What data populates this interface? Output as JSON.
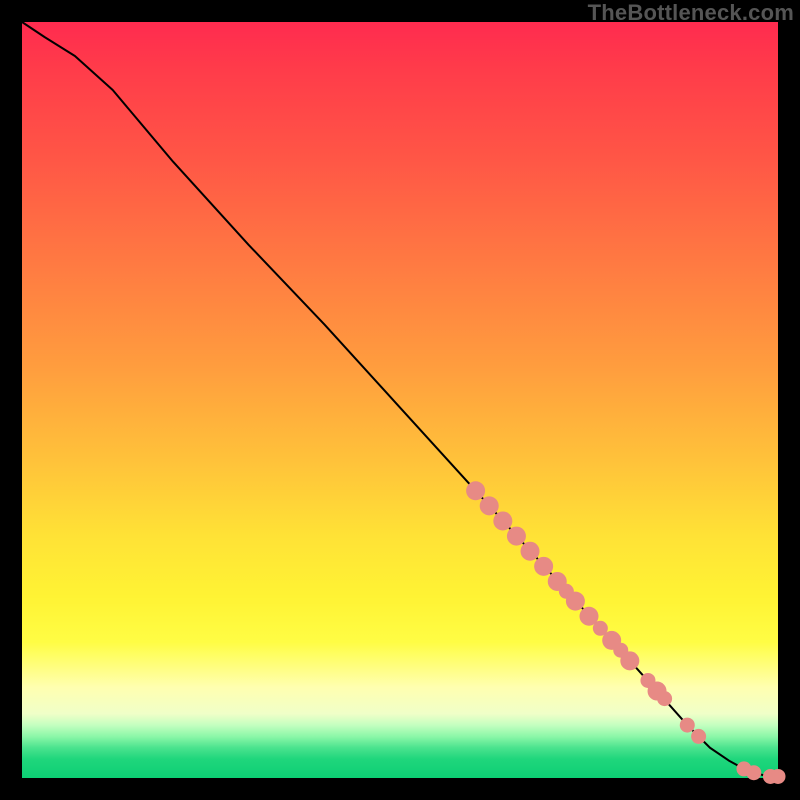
{
  "watermark": "TheBottleneck.com",
  "chart_data": {
    "type": "line",
    "title": "",
    "xlabel": "",
    "ylabel": "",
    "xlim": [
      0,
      100
    ],
    "ylim": [
      0,
      100
    ],
    "grid": false,
    "series": [
      {
        "name": "curve",
        "type": "line",
        "color": "#000000",
        "x": [
          0,
          3,
          7,
          12,
          20,
          30,
          40,
          50,
          60,
          70,
          78,
          84,
          88,
          91,
          93.5,
          95.5,
          97.5,
          99,
          100
        ],
        "y": [
          100,
          98,
          95.5,
          91,
          81.5,
          70.5,
          60,
          49,
          38,
          27,
          18.2,
          11.5,
          7,
          4,
          2.3,
          1.2,
          0.5,
          0.2,
          0.2
        ]
      },
      {
        "name": "markers",
        "type": "scatter",
        "color": "#e78a85",
        "radius_large": 9.5,
        "radius_small": 7.5,
        "points": [
          {
            "x": 60.0,
            "y": 38.0,
            "r": "large"
          },
          {
            "x": 61.8,
            "y": 36.0,
            "r": "large"
          },
          {
            "x": 63.6,
            "y": 34.0,
            "r": "large"
          },
          {
            "x": 65.4,
            "y": 32.0,
            "r": "large"
          },
          {
            "x": 67.2,
            "y": 30.0,
            "r": "large"
          },
          {
            "x": 69.0,
            "y": 28.0,
            "r": "large"
          },
          {
            "x": 70.8,
            "y": 26.0,
            "r": "large"
          },
          {
            "x": 72.0,
            "y": 24.7,
            "r": "small"
          },
          {
            "x": 73.2,
            "y": 23.4,
            "r": "large"
          },
          {
            "x": 75.0,
            "y": 21.4,
            "r": "large"
          },
          {
            "x": 76.5,
            "y": 19.8,
            "r": "small"
          },
          {
            "x": 78.0,
            "y": 18.2,
            "r": "large"
          },
          {
            "x": 79.2,
            "y": 16.9,
            "r": "small"
          },
          {
            "x": 80.4,
            "y": 15.5,
            "r": "large"
          },
          {
            "x": 82.8,
            "y": 12.9,
            "r": "small"
          },
          {
            "x": 84.0,
            "y": 11.5,
            "r": "large"
          },
          {
            "x": 85.0,
            "y": 10.5,
            "r": "small"
          },
          {
            "x": 88.0,
            "y": 7.0,
            "r": "small"
          },
          {
            "x": 89.5,
            "y": 5.5,
            "r": "small"
          },
          {
            "x": 95.5,
            "y": 1.2,
            "r": "small"
          },
          {
            "x": 96.8,
            "y": 0.7,
            "r": "small"
          },
          {
            "x": 99.0,
            "y": 0.2,
            "r": "small"
          },
          {
            "x": 100.0,
            "y": 0.2,
            "r": "small"
          }
        ]
      }
    ]
  }
}
